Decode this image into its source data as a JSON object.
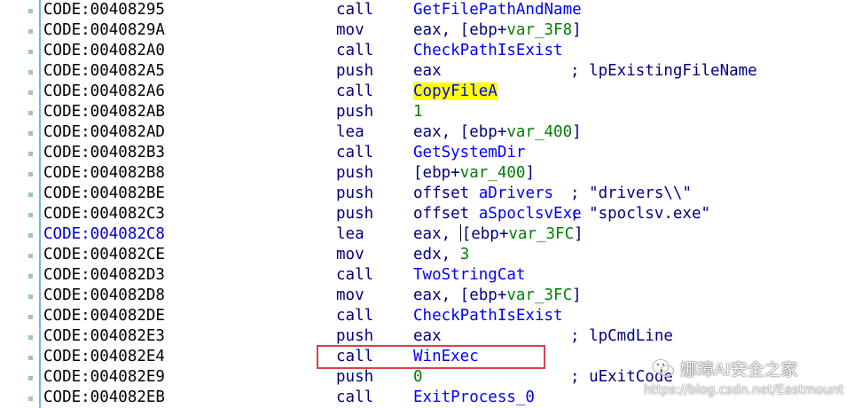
{
  "listing": {
    "rows": [
      {
        "addr": "CODE:00408295",
        "mnem": "call",
        "ops": [
          {
            "t": "GetFilePathAndName",
            "c": "name"
          }
        ],
        "comment": ""
      },
      {
        "addr": "CODE:0040829A",
        "mnem": "mov",
        "ops": [
          {
            "t": "eax, [ebp+",
            "c": "plain"
          },
          {
            "t": "var_3F8",
            "c": "var"
          },
          {
            "t": "]",
            "c": "plain"
          }
        ],
        "comment": ""
      },
      {
        "addr": "CODE:004082A0",
        "mnem": "call",
        "ops": [
          {
            "t": "CheckPathIsExist",
            "c": "name"
          }
        ],
        "comment": ""
      },
      {
        "addr": "CODE:004082A5",
        "mnem": "push",
        "ops": [
          {
            "t": "eax",
            "c": "plain"
          }
        ],
        "comment": "; lpExistingFileName"
      },
      {
        "addr": "CODE:004082A6",
        "mnem": "call",
        "ops": [
          {
            "t": "CopyFileA",
            "c": "hl"
          }
        ],
        "comment": ""
      },
      {
        "addr": "CODE:004082AB",
        "mnem": "push",
        "ops": [
          {
            "t": "1",
            "c": "num"
          }
        ],
        "comment": ""
      },
      {
        "addr": "CODE:004082AD",
        "mnem": "lea",
        "ops": [
          {
            "t": "eax, [ebp+",
            "c": "plain"
          },
          {
            "t": "var_400",
            "c": "var"
          },
          {
            "t": "]",
            "c": "plain"
          }
        ],
        "comment": ""
      },
      {
        "addr": "CODE:004082B3",
        "mnem": "call",
        "ops": [
          {
            "t": "GetSystemDir",
            "c": "name"
          }
        ],
        "comment": ""
      },
      {
        "addr": "CODE:004082B8",
        "mnem": "push",
        "ops": [
          {
            "t": "[ebp+",
            "c": "plain"
          },
          {
            "t": "var_400",
            "c": "var"
          },
          {
            "t": "]",
            "c": "plain"
          }
        ],
        "comment": ""
      },
      {
        "addr": "CODE:004082BE",
        "mnem": "push",
        "ops": [
          {
            "t": "offset ",
            "c": "plain"
          },
          {
            "t": "aDrivers",
            "c": "name"
          }
        ],
        "comment": "; \"drivers\\\\\""
      },
      {
        "addr": "CODE:004082C3",
        "mnem": "push",
        "ops": [
          {
            "t": "offset ",
            "c": "plain"
          },
          {
            "t": "aSpoclsvExe",
            "c": "name"
          }
        ],
        "comment": "; \"spoclsv.exe\""
      },
      {
        "addr": "CODE:004082C8",
        "mnem": "lea",
        "ops": [
          {
            "t": "eax, ",
            "c": "plain"
          },
          {
            "t": "",
            "c": "caret"
          },
          {
            "t": "[ebp+",
            "c": "plain"
          },
          {
            "t": "var_3FC",
            "c": "var"
          },
          {
            "t": "]",
            "c": "plain"
          }
        ],
        "comment": "",
        "xref": true
      },
      {
        "addr": "CODE:004082CE",
        "mnem": "mov",
        "ops": [
          {
            "t": "edx, ",
            "c": "plain"
          },
          {
            "t": "3",
            "c": "num"
          }
        ],
        "comment": ""
      },
      {
        "addr": "CODE:004082D3",
        "mnem": "call",
        "ops": [
          {
            "t": "TwoStringCat",
            "c": "name"
          }
        ],
        "comment": ""
      },
      {
        "addr": "CODE:004082D8",
        "mnem": "mov",
        "ops": [
          {
            "t": "eax, [ebp+",
            "c": "plain"
          },
          {
            "t": "var_3FC",
            "c": "var"
          },
          {
            "t": "]",
            "c": "plain"
          }
        ],
        "comment": ""
      },
      {
        "addr": "CODE:004082DE",
        "mnem": "call",
        "ops": [
          {
            "t": "CheckPathIsExist",
            "c": "name"
          }
        ],
        "comment": ""
      },
      {
        "addr": "CODE:004082E3",
        "mnem": "push",
        "ops": [
          {
            "t": "eax",
            "c": "plain"
          }
        ],
        "comment": "; lpCmdLine"
      },
      {
        "addr": "CODE:004082E4",
        "mnem": "call",
        "ops": [
          {
            "t": "WinExec",
            "c": "name"
          }
        ],
        "comment": ""
      },
      {
        "addr": "CODE:004082E9",
        "mnem": "push",
        "ops": [
          {
            "t": "0",
            "c": "num"
          }
        ],
        "comment": "; uExitCode"
      },
      {
        "addr": "CODE:004082EB",
        "mnem": "call",
        "ops": [
          {
            "t": "ExitProcess_0",
            "c": "name"
          }
        ],
        "comment": ""
      }
    ]
  },
  "watermark": {
    "name": "娜璋AI安全之家",
    "url": "https://blog.csdn.net/Eastmount",
    "icon": "wechat-icon"
  },
  "colors": {
    "highlight": "#ffff00",
    "redbox": "#d9414b",
    "name": "#0000ff",
    "number": "#008000"
  }
}
